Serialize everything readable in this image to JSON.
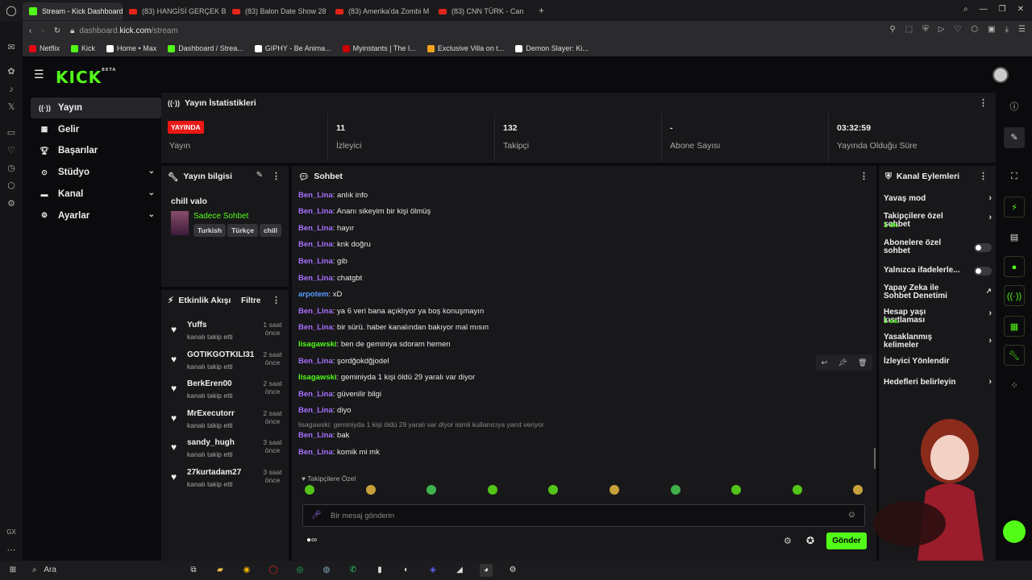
{
  "browser": {
    "tabs": [
      {
        "label": "Stream - Kick Dashboard",
        "icon": "kick"
      },
      {
        "label": "(83) HANGİSİ GERÇEK BA",
        "icon": "youtube"
      },
      {
        "label": "(83) Balon Date Show 28",
        "icon": "youtube"
      },
      {
        "label": "(83) Amerika'da Zombi M",
        "icon": "youtube"
      },
      {
        "label": "(83) CNN TÜRK - Can",
        "icon": "youtube"
      }
    ],
    "url_host": "dashboard.",
    "url_main": "kick.com",
    "url_path": "/stream",
    "bookmarks": [
      {
        "label": "Netflix",
        "color": "#e50914"
      },
      {
        "label": "Kick",
        "color": "#53fc18"
      },
      {
        "label": "Home • Max",
        "color": "#ffffff"
      },
      {
        "label": "Dashboard / Strea...",
        "color": "#53fc18"
      },
      {
        "label": "GIPHY - Be Anima...",
        "color": "#ffffff"
      },
      {
        "label": "Myinstants | The I...",
        "color": "#cc0000"
      },
      {
        "label": "Exclusive Villa on t...",
        "color": "#f2a31b"
      },
      {
        "label": "Demon Slayer: Ki...",
        "color": "#ffffff"
      }
    ]
  },
  "kick": {
    "logo": "KICK",
    "logo_badge": "BETA",
    "sidebar": [
      {
        "label": "Yayın",
        "icon": "broadcast-icon",
        "active": true
      },
      {
        "label": "Gelir",
        "icon": "revenue-icon"
      },
      {
        "label": "Başarılar",
        "icon": "trophy-icon"
      },
      {
        "label": "Stüdyo",
        "icon": "studio-icon",
        "chevron": true
      },
      {
        "label": "Kanal",
        "icon": "channel-icon",
        "chevron": true
      },
      {
        "label": "Ayarlar",
        "icon": "gear-icon",
        "chevron": true
      }
    ],
    "stats": {
      "title": "Yayın İstatistikleri",
      "live_badge": "YAYINDA",
      "cells": [
        {
          "value": "",
          "label": "Yayın"
        },
        {
          "value": "11",
          "label": "İzleyici"
        },
        {
          "value": "132",
          "label": "Takipçi"
        },
        {
          "value": "-",
          "label": "Abone Sayısı"
        },
        {
          "value": "03:32:59",
          "label": "Yayında Olduğu Süre"
        }
      ]
    },
    "stream_info": {
      "title": "Yayın bilgisi",
      "stream_title": "chill valo",
      "category": "Sadece Sohbet",
      "tags": [
        "Turkish",
        "Türkçe",
        "chill"
      ]
    },
    "activity": {
      "title": "Etkinlik Akışı",
      "filter": "Filtre",
      "items": [
        {
          "name": "Yuffs",
          "desc": "kanalı takip etti",
          "time": "1 saat önce"
        },
        {
          "name": "GOTIKGOTKILI31",
          "desc": "kanalı takip etti",
          "time": "2 saat önce"
        },
        {
          "name": "BerkEren00",
          "desc": "kanalı takip etti",
          "time": "2 saat önce"
        },
        {
          "name": "MrExecutorr",
          "desc": "kanalı takip etti",
          "time": "2 saat önce"
        },
        {
          "name": "sandy_hugh",
          "desc": "kanalı takip etti",
          "time": "3 saat önce"
        },
        {
          "name": "27kurtadam27",
          "desc": "kanalı takip etti",
          "time": "3 saat önce"
        }
      ]
    },
    "chat": {
      "title": "Sohbet",
      "messages": [
        {
          "user": "Ben_Lina",
          "color": "purple",
          "text": "yıkım olmuş"
        },
        {
          "user": "Ben_Lina",
          "color": "purple",
          "text": "anlık info"
        },
        {
          "user": "Ben_Lina",
          "color": "purple",
          "text": "Ananı sikeyim bir kişi ölmüş"
        },
        {
          "user": "Ben_Lina",
          "color": "purple",
          "text": "hayır"
        },
        {
          "user": "Ben_Lina",
          "color": "purple",
          "text": "knk doğru"
        },
        {
          "user": "Ben_Lina",
          "color": "purple",
          "text": "gib"
        },
        {
          "user": "Ben_Lina",
          "color": "purple",
          "text": "chatgbt"
        },
        {
          "user": "arpotem",
          "color": "blue",
          "text": "xD"
        },
        {
          "user": "Ben_Lina",
          "color": "purple",
          "text": "ya 6 veri bana açıklıyor ya boş konuşmayın"
        },
        {
          "user": "Ben_Lina",
          "color": "purple",
          "text": "bir sürü. haber kanalından bakıyor mal mısın"
        },
        {
          "user": "lisagawski",
          "color": "green",
          "text": "ben de geminiya sdoram hemen"
        },
        {
          "user": "Ben_Lina",
          "color": "purple",
          "text": "şordğokdğjodel"
        },
        {
          "user": "lisagawski",
          "color": "green",
          "text": "geminiyda 1 kişi öldü 29 yaralı var diyor"
        },
        {
          "user": "Ben_Lina",
          "color": "purple",
          "text": "güvenilir bilgi"
        },
        {
          "user": "Ben_Lina",
          "color": "purple",
          "text": "diyo"
        },
        {
          "reply": "lisagawski: geminiyda 1 kişi öldü 29 yaralı var diyor isimli kullanıcıya yanıt veriyor"
        },
        {
          "user": "Ben_Lina",
          "color": "purple",
          "text": "bak"
        },
        {
          "user": "Ben_Lina",
          "color": "purple",
          "text": "komik mi mk"
        }
      ],
      "emote_section": "Takipçilere Özel",
      "input_placeholder": "Bir mesaj gönderin",
      "send": "Gönder"
    },
    "channel_actions": {
      "title": "Kanal Eylemleri",
      "items": [
        {
          "label": "Yavaş mod",
          "type": "arrow"
        },
        {
          "label": "Takipçilere özel sohbet",
          "sub": "1 dk.",
          "type": "arrow"
        },
        {
          "label": "Abonelere özel sohbet",
          "type": "toggle"
        },
        {
          "label": "Yalnızca ifadelerle...",
          "type": "toggle"
        },
        {
          "label": "Yapay Zeka ile Sohbet Denetimi",
          "type": "link"
        },
        {
          "label": "Hesap yaşı kısıtlaması",
          "sub": "1 sa.",
          "type": "arrow"
        },
        {
          "label": "Yasaklanmış kelimeler",
          "type": "arrow"
        },
        {
          "label": "İzleyici Yönlendir",
          "type": "none"
        },
        {
          "label": "Hedefleri belirleyin",
          "type": "arrow"
        }
      ]
    }
  },
  "taskbar": {
    "search": "Ara"
  }
}
